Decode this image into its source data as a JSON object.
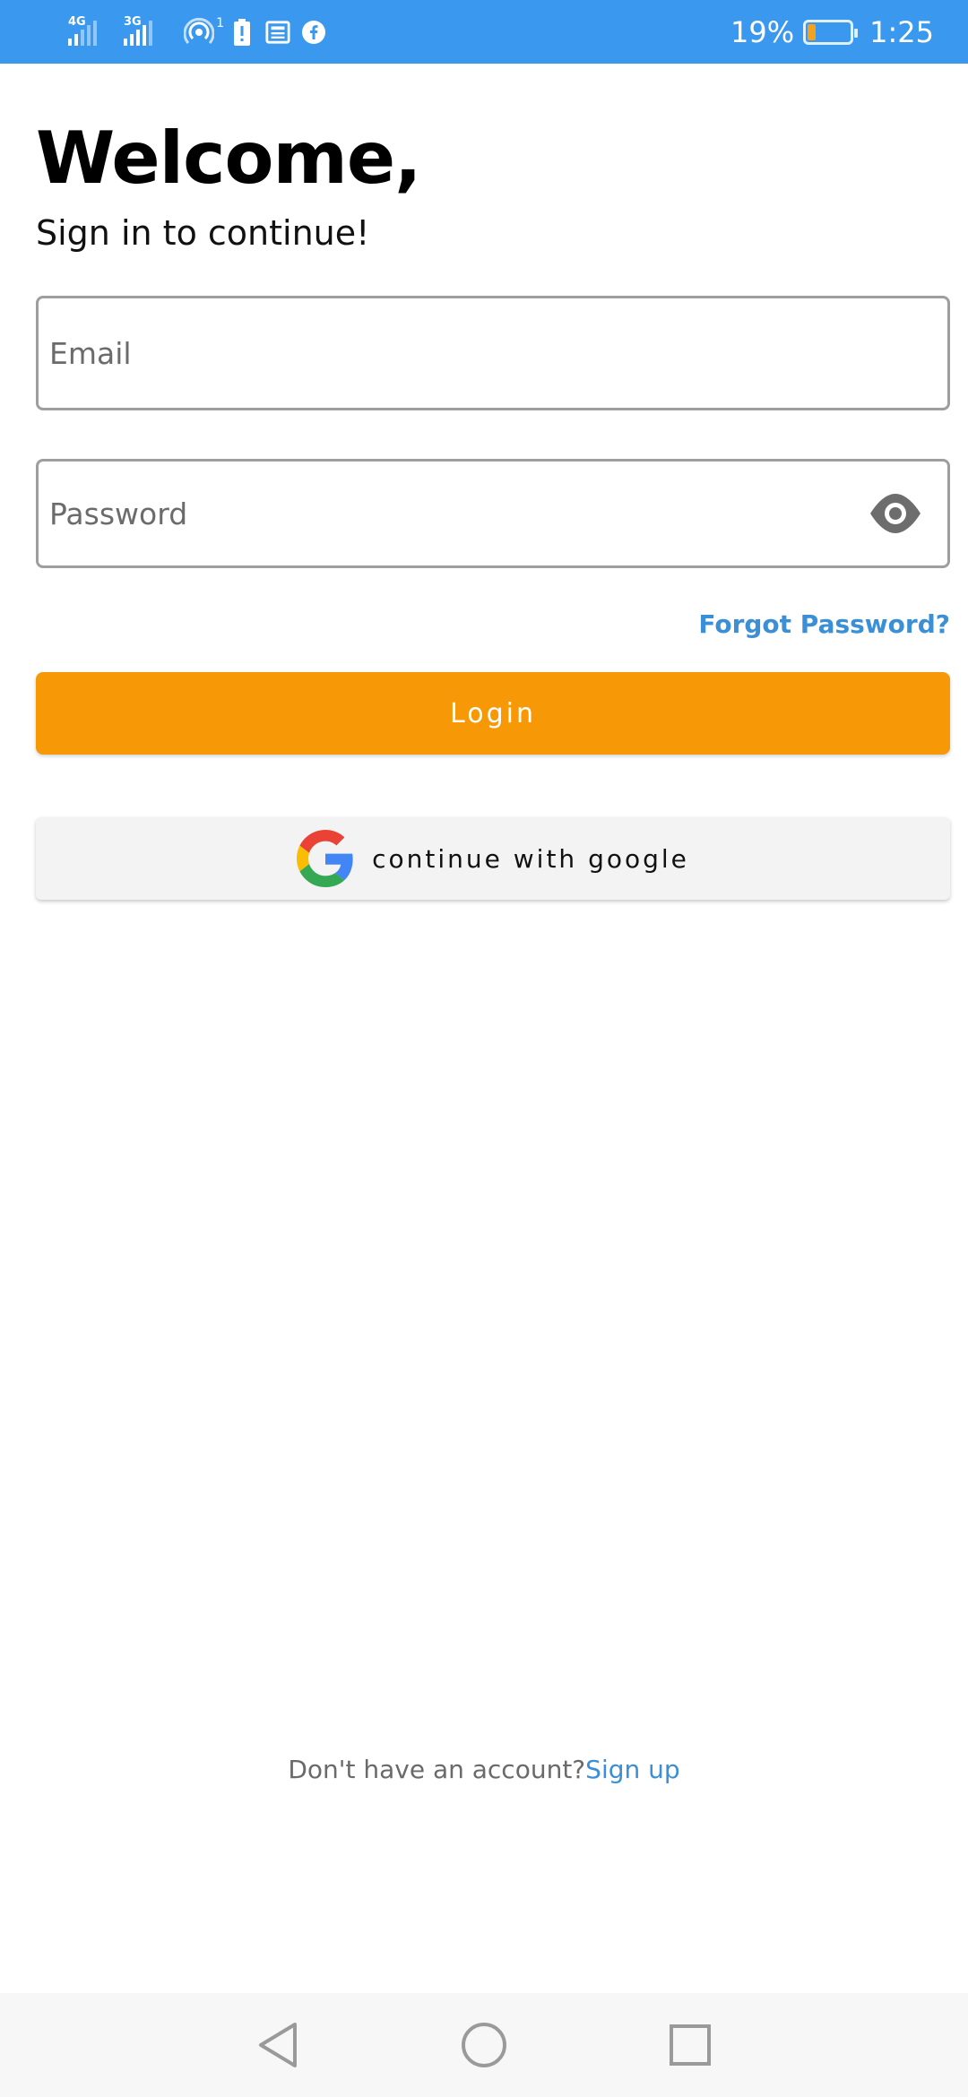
{
  "status_bar": {
    "network_1": "4G",
    "network_2": "3G",
    "hotspot_count": "1",
    "battery_percent": "19%",
    "battery_level": 0.19,
    "time": "1:25",
    "background_color": "#3a98ee"
  },
  "header": {
    "title": "Welcome,",
    "subtitle": "Sign in to continue!"
  },
  "form": {
    "email_placeholder": "Email",
    "email_value": "",
    "password_placeholder": "Password",
    "password_value": "",
    "forgot_password": "Forgot Password?",
    "login_label": "Login",
    "google_label": "continue with google"
  },
  "footer": {
    "signup_prompt": "Don't have an account?",
    "signup_link": "Sign up"
  },
  "colors": {
    "accent_orange": "#f79806",
    "link_blue": "#3a8fd6"
  },
  "icons": {
    "password_toggle": "eye-icon",
    "google": "google-logo-icon",
    "nav_back": "back-triangle-icon",
    "nav_home": "home-circle-icon",
    "nav_recents": "recents-square-icon"
  }
}
